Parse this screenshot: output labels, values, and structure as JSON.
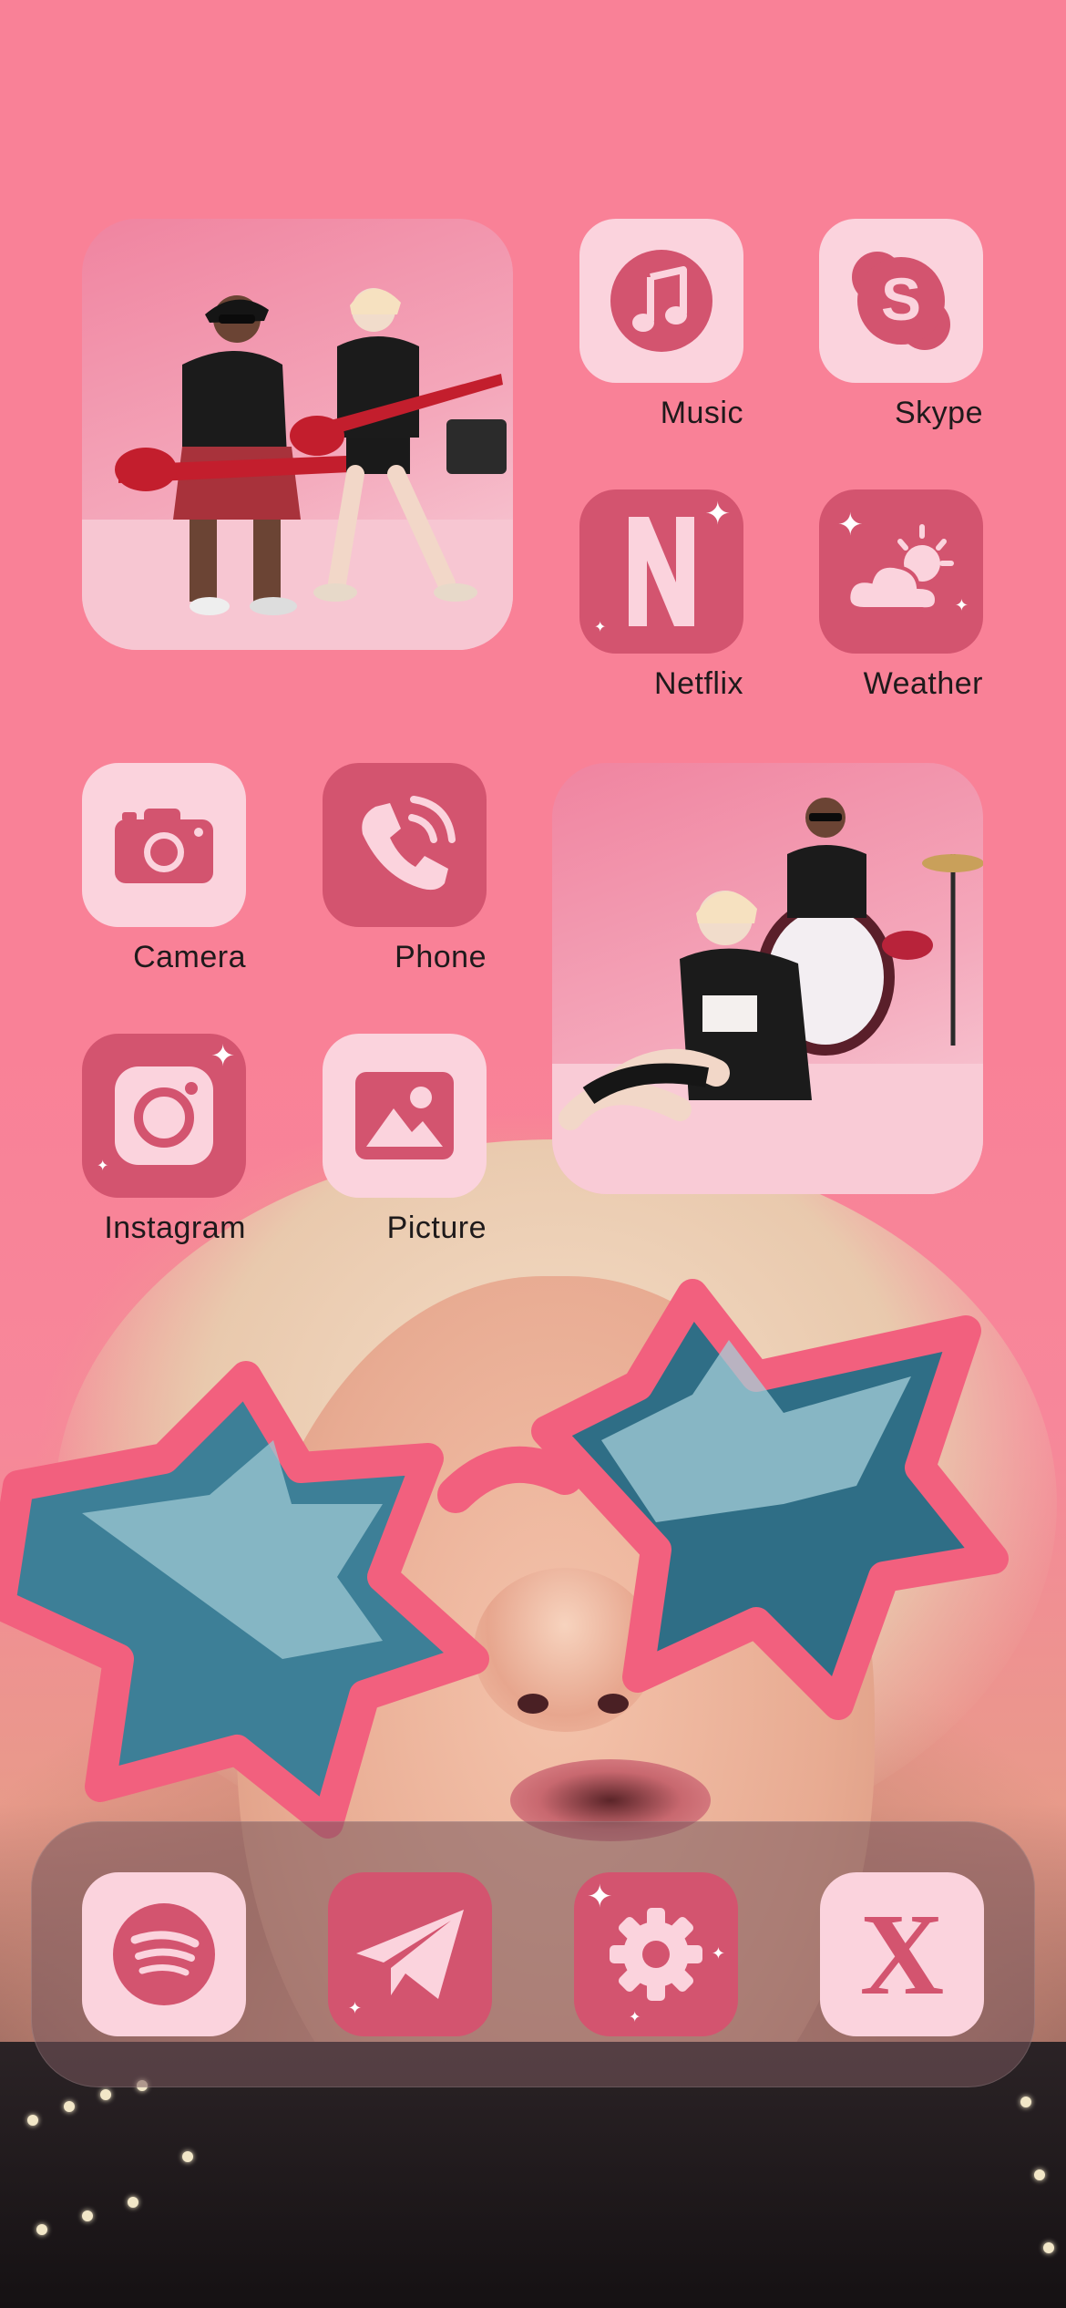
{
  "colors": {
    "background": "#f98197",
    "tile_light": "#fbd3dd",
    "tile_dark": "#d3546f",
    "glyph_dark": "#d3546f",
    "glyph_light": "#fbd3dd"
  },
  "home": {
    "apps": [
      {
        "id": "music",
        "label": "Music",
        "icon": "music-note-icon"
      },
      {
        "id": "skype",
        "label": "Skype",
        "icon": "skype-icon"
      },
      {
        "id": "netflix",
        "label": "Netflix",
        "icon": "netflix-icon"
      },
      {
        "id": "weather",
        "label": "Weather",
        "icon": "weather-icon"
      },
      {
        "id": "camera",
        "label": "Camera",
        "icon": "camera-icon"
      },
      {
        "id": "phone",
        "label": "Phone",
        "icon": "phone-icon"
      },
      {
        "id": "instagram",
        "label": "Instagram",
        "icon": "instagram-icon"
      },
      {
        "id": "picture",
        "label": "Picture",
        "icon": "picture-icon"
      }
    ],
    "widgets": [
      {
        "id": "photo-widget-guitars",
        "content": "photo"
      },
      {
        "id": "photo-widget-drums",
        "content": "photo"
      }
    ]
  },
  "dock": {
    "apps": [
      {
        "id": "spotify",
        "icon": "spotify-icon"
      },
      {
        "id": "telegram",
        "icon": "telegram-icon"
      },
      {
        "id": "settings",
        "icon": "settings-gear-icon"
      },
      {
        "id": "x",
        "icon": "x-icon",
        "glyph": "X"
      }
    ]
  }
}
